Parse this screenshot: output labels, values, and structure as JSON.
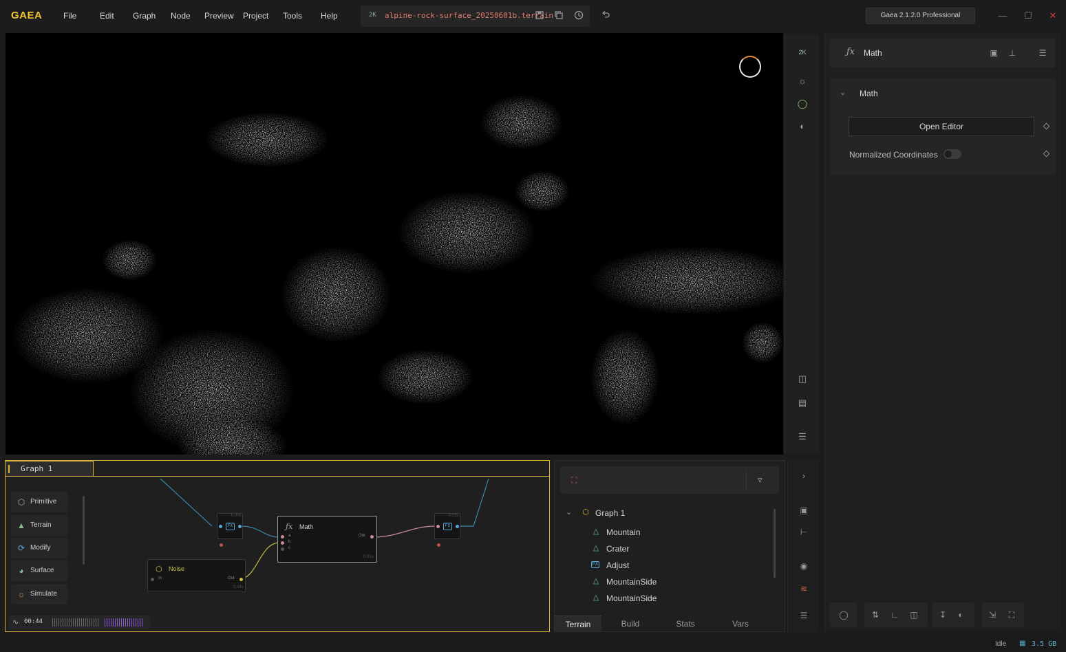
{
  "app": {
    "logo": "GAEA"
  },
  "menu": [
    "File",
    "Edit",
    "Graph",
    "Node",
    "Preview",
    "Project",
    "Tools",
    "Help"
  ],
  "file": {
    "resolution": "2K",
    "name": "alpine-rock-surface_20250601b.terrain"
  },
  "version": "Gaea 2.1.2.0 Professional",
  "viewport_toolbar": {
    "resolution": "2K"
  },
  "properties": {
    "node_name": "Math",
    "section_title": "Math",
    "open_editor_label": "Open Editor",
    "normalized_coordinates_label": "Normalized Coordinates"
  },
  "graph": {
    "tab_label": "Graph 1",
    "tools": [
      "Primitive",
      "Terrain",
      "Modify",
      "Surface",
      "Simulate"
    ],
    "nodes": {
      "math": {
        "title": "Math",
        "inputs": [
          "a",
          "b",
          "c"
        ],
        "output": "Out",
        "time": "0.01s"
      },
      "noise": {
        "title": "Noise",
        "input": "In",
        "output": "Out",
        "time": "0.04s"
      },
      "fx1": {
        "label": "FX",
        "time": "0.00s"
      },
      "fx2": {
        "label": "FX",
        "time": "0.03s"
      }
    },
    "timer": "00:44"
  },
  "explorer": {
    "root": "Graph 1",
    "items": [
      "Mountain",
      "Crater",
      "Adjust",
      "MountainSide",
      "MountainSide"
    ],
    "tabs": [
      "Terrain",
      "Build",
      "Stats",
      "Vars"
    ],
    "active_tab": "Terrain"
  },
  "status": {
    "state": "Idle",
    "memory": "3.5 GB"
  },
  "colors": {
    "accent": "#e0b830",
    "file_name": "#e07a6a",
    "wire_blue": "#3a86a8",
    "wire_pink": "#c98a9a",
    "wire_yellow": "#c8b840"
  }
}
